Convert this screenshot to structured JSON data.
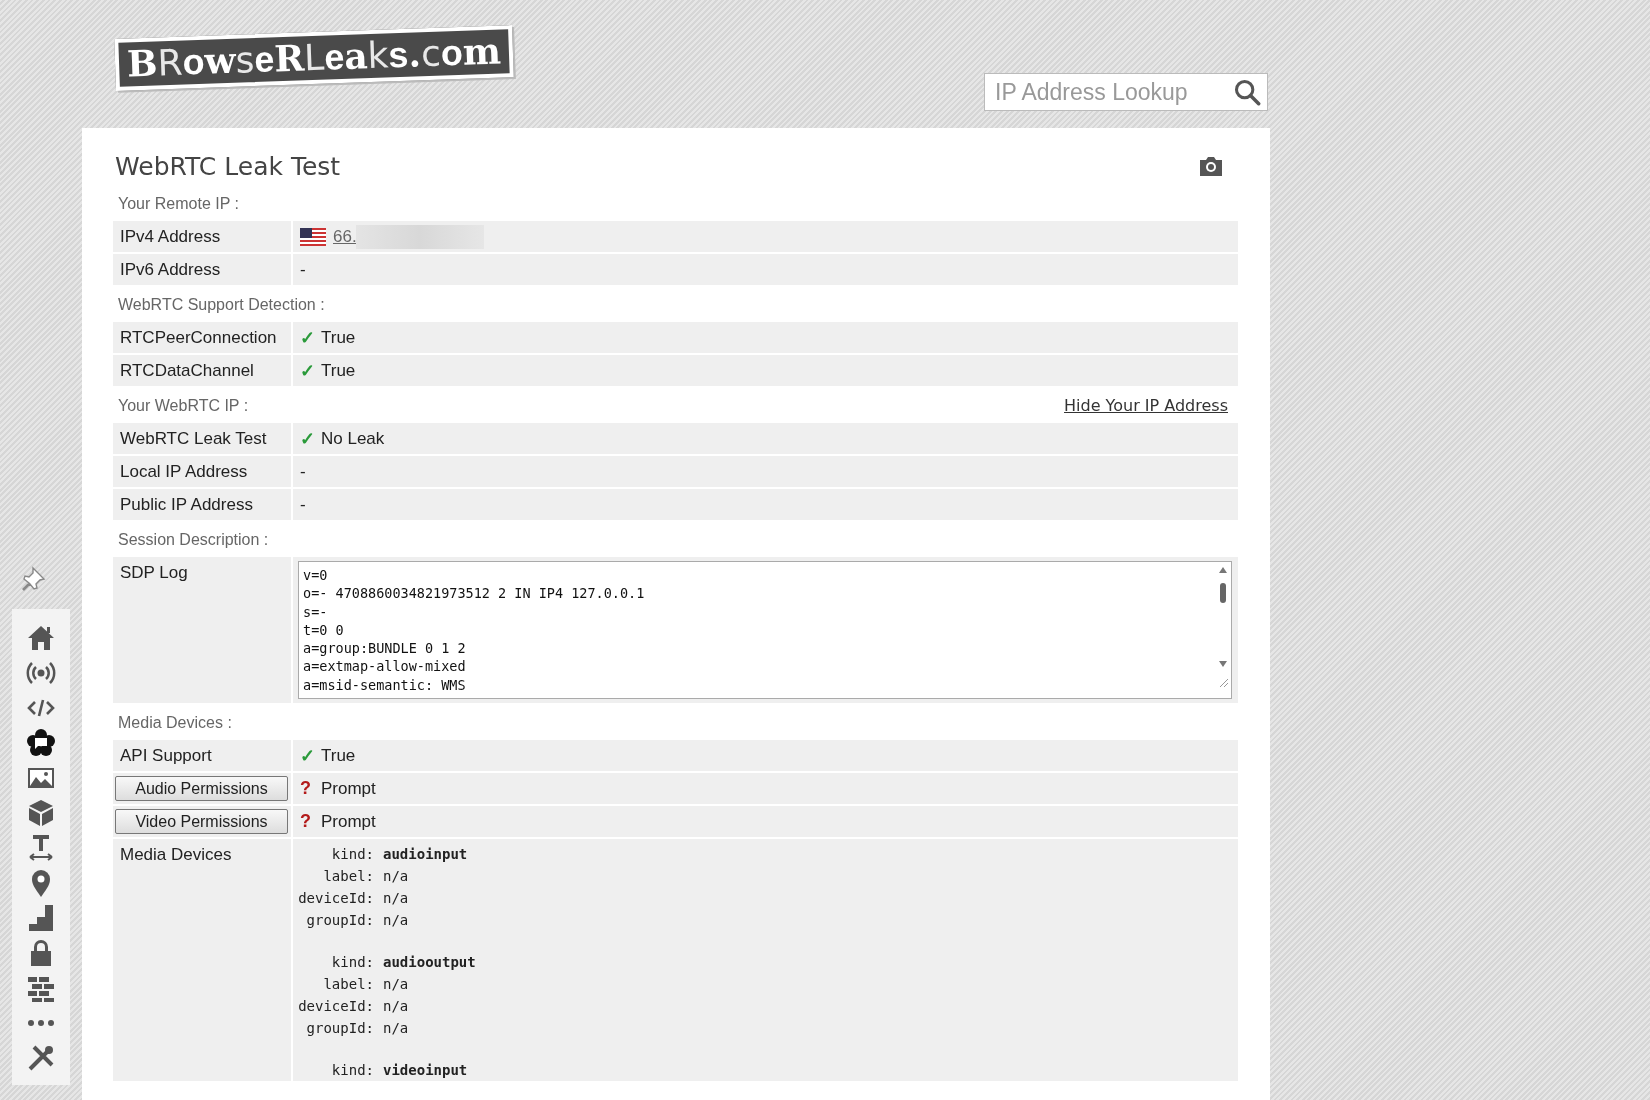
{
  "logo": {
    "text": "BRowseRLeaks.com"
  },
  "search": {
    "placeholder": "IP Address Lookup"
  },
  "sidebar": {
    "items": [
      {
        "kind": "home"
      },
      {
        "kind": "broadcast"
      },
      {
        "kind": "code"
      },
      {
        "kind": "chat"
      },
      {
        "kind": "image"
      },
      {
        "kind": "cube"
      },
      {
        "kind": "text-width"
      },
      {
        "kind": "map-pin"
      },
      {
        "kind": "stairs"
      },
      {
        "kind": "lock"
      },
      {
        "kind": "bricks"
      },
      {
        "kind": "dots"
      },
      {
        "kind": "tools"
      }
    ]
  },
  "title": "WebRTC Leak Test",
  "sections": [
    {
      "heading": "Your Remote IP :",
      "rows": [
        {
          "kind": "ip",
          "label": "IPv4 Address",
          "value": "66."
        },
        {
          "kind": "text",
          "label": "IPv6 Address",
          "value": "-"
        }
      ]
    },
    {
      "heading": "WebRTC Support Detection :",
      "rows": [
        {
          "kind": "status",
          "label": "RTCPeerConnection",
          "mark": "✓",
          "prompt": false,
          "value": "True"
        },
        {
          "kind": "status",
          "label": "RTCDataChannel",
          "mark": "✓",
          "prompt": false,
          "value": "True"
        }
      ]
    },
    {
      "heading": "Your WebRTC IP :",
      "link": "Hide Your IP Address",
      "rows": [
        {
          "kind": "status",
          "label": "WebRTC Leak Test",
          "mark": "✓",
          "prompt": false,
          "value": "No Leak"
        },
        {
          "kind": "text",
          "label": "Local IP Address",
          "value": "-"
        },
        {
          "kind": "text",
          "label": "Public IP Address",
          "value": "-"
        }
      ]
    },
    {
      "heading": "Session Description :",
      "rows": [
        {
          "kind": "log",
          "label": "SDP Log",
          "lines": [
            "v=0",
            "o=- 4708860034821973512 2 IN IP4 127.0.0.1",
            "s=-",
            "t=0 0",
            "a=group:BUNDLE 0 1 2",
            "a=extmap-allow-mixed",
            "a=msid-semantic: WMS"
          ]
        }
      ]
    },
    {
      "heading": "Media Devices :",
      "rows": [
        {
          "kind": "status",
          "label": "API Support",
          "mark": "✓",
          "prompt": false,
          "value": "True"
        },
        {
          "kind": "button",
          "label": "Audio Permissions",
          "mark": "?",
          "prompt": true,
          "value": "Prompt"
        },
        {
          "kind": "button",
          "label": "Video Permissions",
          "mark": "?",
          "prompt": true,
          "value": "Prompt"
        },
        {
          "kind": "devices",
          "label": "Media Devices",
          "devices": [
            {
              "lines": [
                {
                  "key": "kind:",
                  "value": "audioinput",
                  "strong": true
                },
                {
                  "key": "label:",
                  "value": "n/a",
                  "strong": false
                },
                {
                  "key": "deviceId:",
                  "value": "n/a",
                  "strong": false
                },
                {
                  "key": "groupId:",
                  "value": "n/a",
                  "strong": false
                }
              ]
            },
            {
              "lines": [
                {
                  "key": "kind:",
                  "value": "audiooutput",
                  "strong": true
                },
                {
                  "key": "label:",
                  "value": "n/a",
                  "strong": false
                },
                {
                  "key": "deviceId:",
                  "value": "n/a",
                  "strong": false
                },
                {
                  "key": "groupId:",
                  "value": "n/a",
                  "strong": false
                }
              ]
            },
            {
              "lines": [
                {
                  "key": "kind:",
                  "value": "videoinput",
                  "strong": true
                }
              ]
            }
          ]
        }
      ]
    }
  ]
}
